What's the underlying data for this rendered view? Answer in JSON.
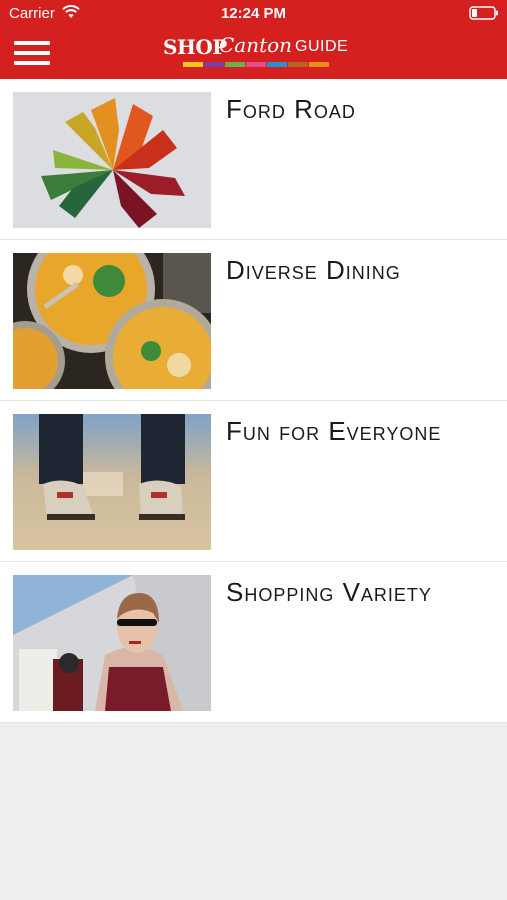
{
  "status_bar": {
    "carrier": "Carrier",
    "time": "12:24 PM",
    "icons": [
      "wifi-icon",
      "battery-icon"
    ]
  },
  "nav": {
    "menu_icon": "hamburger-menu-icon",
    "logo": {
      "shop": "SHOP",
      "canton": "Canton",
      "guide": "GUIDE",
      "stripe_colors": [
        "#f5c518",
        "#7a3fa0",
        "#6ab04c",
        "#e84a8a",
        "#2a8fd0",
        "#b5651d",
        "#f08c1e"
      ]
    }
  },
  "colors": {
    "header_red": "#d52020",
    "background": "#efefef"
  },
  "items": [
    {
      "title": "Ford Road",
      "image": "autumn-leaves-image"
    },
    {
      "title": "Diverse Dining",
      "image": "soup-bowls-image"
    },
    {
      "title": "Fun for Everyone",
      "image": "bowling-shoes-image"
    },
    {
      "title": "Shopping Variety",
      "image": "shopper-woman-image"
    }
  ]
}
